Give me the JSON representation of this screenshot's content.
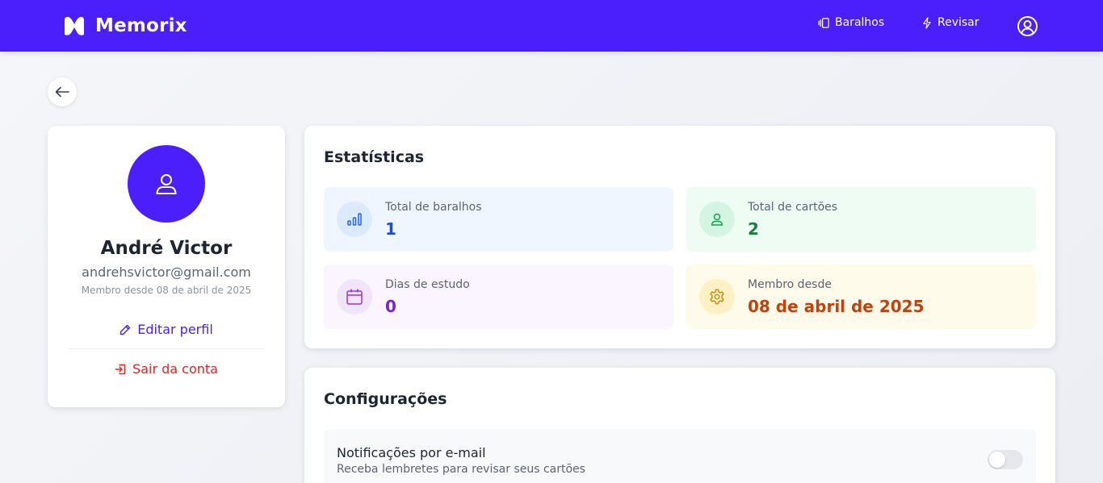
{
  "app": {
    "name": "Memorix",
    "brand_color": "#4a1ffb",
    "logo_icon": "memorix-logo"
  },
  "nav": {
    "decks_label": "Baralhos",
    "decks_icon": "cards-icon",
    "review_label": "Revisar",
    "review_icon": "lightning-icon",
    "user_icon": "user-circle-icon"
  },
  "back": {
    "icon": "arrow-left-icon"
  },
  "profile": {
    "name": "André Victor",
    "email": "andrehsvictor@gmail.com",
    "member_since": "Membro desde 08 de abril de 2025",
    "edit_label": "Editar perfil",
    "logout_label": "Sair da conta"
  },
  "stats": {
    "title": "Estatísticas",
    "items": [
      {
        "label": "Total de baralhos",
        "value": "1",
        "icon": "bar-chart-icon",
        "color": "#1d4ed8"
      },
      {
        "label": "Total de cartões",
        "value": "2",
        "icon": "user-icon",
        "color": "#15803d"
      },
      {
        "label": "Dias de estudo",
        "value": "0",
        "icon": "calendar-icon",
        "color": "#7e22ce"
      },
      {
        "label": "Membro desde",
        "value": "08 de abril de 2025",
        "icon": "gear-icon",
        "color": "#c2410c"
      }
    ]
  },
  "config": {
    "title": "Configurações",
    "settings": [
      {
        "title": "Notificações por e-mail",
        "description": "Receba lembretes para revisar seus cartões",
        "enabled": false
      }
    ]
  }
}
